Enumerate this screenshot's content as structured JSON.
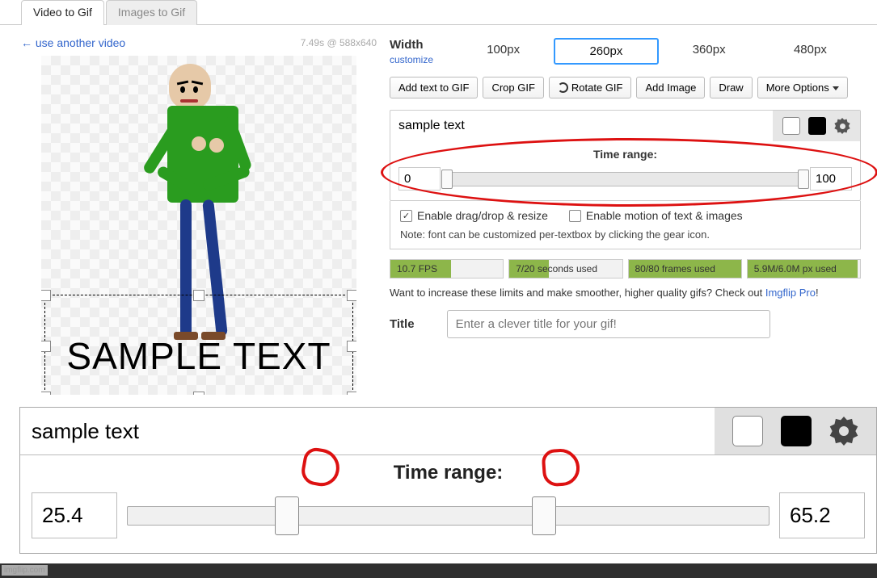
{
  "tabs": {
    "video": "Video to Gif",
    "images": "Images to Gif"
  },
  "use_another": "← use another video",
  "source_dims": "7.49s @ 588x640",
  "overlay_text": "SAMPLE TEXT",
  "width": {
    "label": "Width",
    "customize": "customize",
    "options": [
      "100px",
      "260px",
      "360px",
      "480px"
    ],
    "selected": "260px"
  },
  "toolbar": {
    "add_text": "Add text to GIF",
    "crop": "Crop GIF",
    "rotate": "Rotate GIF",
    "add_image": "Add Image",
    "draw": "Draw",
    "more": "More Options"
  },
  "textbox": {
    "value": "sample text",
    "colors": {
      "fg": "#ffffff",
      "outline": "#000000"
    }
  },
  "time_range": {
    "label": "Time range:",
    "start": "0",
    "end": "100"
  },
  "checks": {
    "drag_label": "Enable drag/drop & resize",
    "drag_checked": true,
    "motion_label": "Enable motion of text & images",
    "motion_checked": false,
    "note": "Note: font can be customized per-textbox by clicking the gear icon."
  },
  "stats": {
    "fps": {
      "text": "10.7 FPS",
      "pct": 54
    },
    "seconds": {
      "text": "7/20 seconds used",
      "pct": 35
    },
    "frames": {
      "text": "80/80 frames used",
      "pct": 100
    },
    "px": {
      "text": "5.9M/6.0M px used",
      "pct": 98
    }
  },
  "promo": {
    "text": "Want to increase these limits and make smoother, higher quality gifs? Check out ",
    "link": "Imgflip Pro",
    "suffix": "!"
  },
  "title": {
    "label": "Title",
    "placeholder": "Enter a clever title for your gif!"
  },
  "zoom": {
    "text_value": "sample text",
    "range_label": "Time range:",
    "start": "25.4",
    "end": "65.2"
  },
  "watermark": "imgflip.com"
}
